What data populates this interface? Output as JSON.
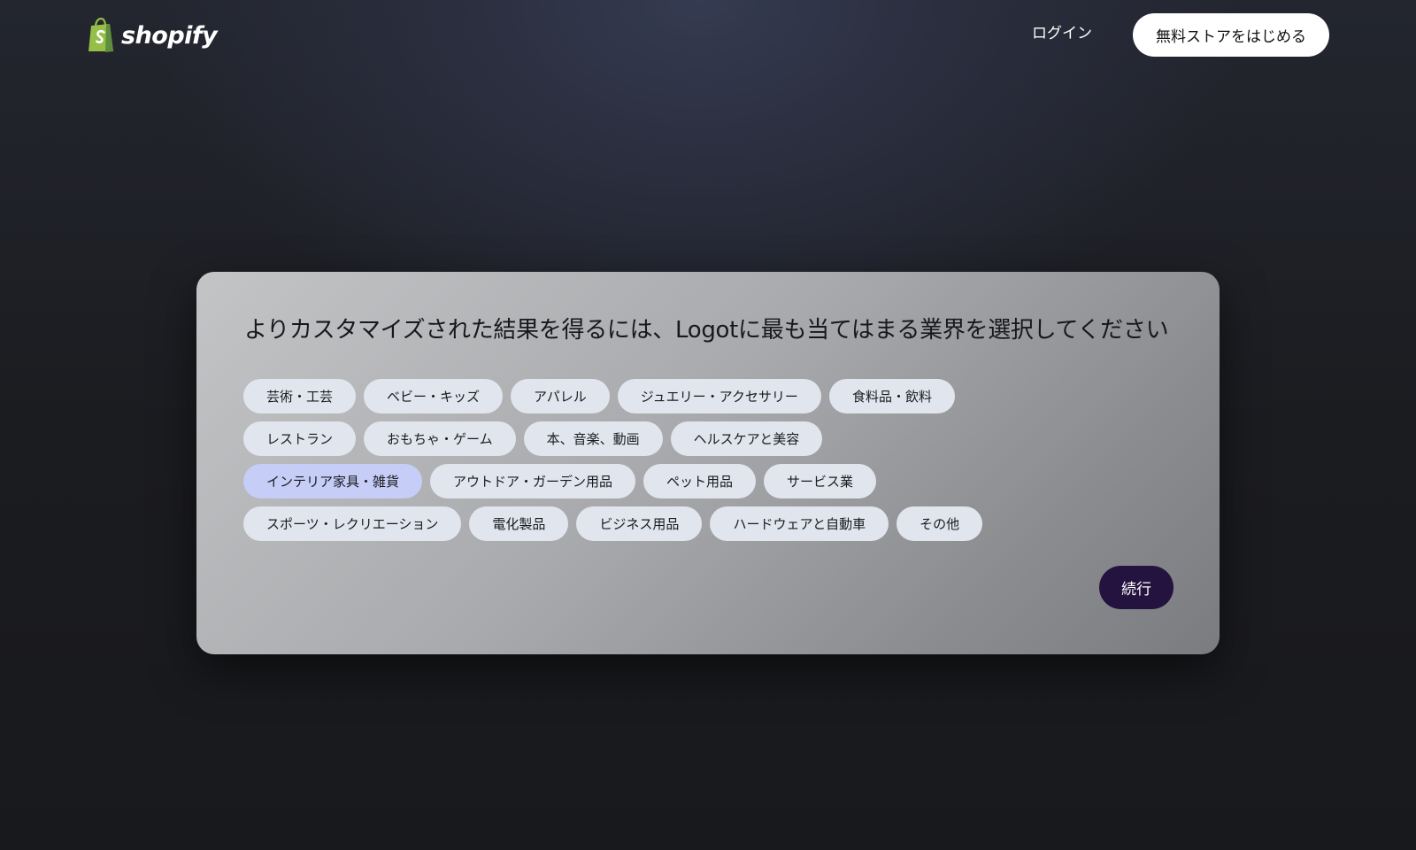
{
  "header": {
    "logo_text": "shopify",
    "login_label": "ログイン",
    "start_button_label": "無料ストアをはじめる"
  },
  "card": {
    "title": "よりカスタマイズされた結果を得るには、Logotに最も当てはまる業界を選択してください",
    "rows": [
      [
        {
          "label": "芸術・工芸",
          "selected": false
        },
        {
          "label": "ベビー・キッズ",
          "selected": false
        },
        {
          "label": "アパレル",
          "selected": false
        },
        {
          "label": "ジュエリー・アクセサリー",
          "selected": false
        },
        {
          "label": "食料品・飲料",
          "selected": false
        }
      ],
      [
        {
          "label": "レストラン",
          "selected": false
        },
        {
          "label": "おもちゃ・ゲーム",
          "selected": false
        },
        {
          "label": "本、音楽、動画",
          "selected": false
        },
        {
          "label": "ヘルスケアと美容",
          "selected": false
        }
      ],
      [
        {
          "label": "インテリア家具・雑貨",
          "selected": true
        },
        {
          "label": "アウトドア・ガーデン用品",
          "selected": false
        },
        {
          "label": "ペット用品",
          "selected": false
        },
        {
          "label": "サービス業",
          "selected": false
        }
      ],
      [
        {
          "label": "スポーツ・レクリエーション",
          "selected": false
        },
        {
          "label": "電化製品",
          "selected": false
        },
        {
          "label": "ビジネス用品",
          "selected": false
        },
        {
          "label": "ハードウェアと自動車",
          "selected": false
        },
        {
          "label": "その他",
          "selected": false
        }
      ]
    ],
    "continue_label": "続行"
  },
  "colors": {
    "chip": "#e1e5ee",
    "chip_selected": "#c6cdf7",
    "continue_button": "#24123f",
    "logo_green": "#95bf47"
  },
  "icons": {
    "logo": "shopify-bag-icon"
  }
}
